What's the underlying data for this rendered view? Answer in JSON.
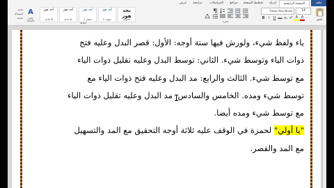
{
  "ribbon": {
    "tabs": [
      {
        "label": "ملف"
      },
      {
        "label": "الصفحة الرئيسية"
      },
      {
        "label": "إدراج"
      },
      {
        "label": "تخطيط الصفحة"
      },
      {
        "label": "مراجع"
      },
      {
        "label": "المراسلات"
      },
      {
        "label": "مراجعة"
      },
      {
        "label": "عرض"
      }
    ],
    "clipboard": {
      "paste_label": "لصق"
    },
    "font": {
      "name": "Times New Roma",
      "size": "14"
    },
    "format_buttons": [
      "B",
      "I",
      "U",
      "abc",
      "x₂",
      "x²",
      "A",
      "A"
    ],
    "paragraph_label": "فقرة",
    "styles": [
      {
        "sample": "أجد هوز",
        "name": "¶ عادي"
      },
      {
        "sample": "أجد هوز",
        "name": "بلا تباعد"
      },
      {
        "sample": "أجد هوز",
        "name": "عنوان 1"
      },
      {
        "sample": "أجد هوز",
        "name": "عنوان 2"
      },
      {
        "sample": "بجد هوز",
        "name": "العنوان"
      }
    ],
    "styles_label": "أنماط",
    "change_styles": {
      "glyph": "A",
      "label": "تغيير الأنماط"
    },
    "editing": [
      "بحث",
      "استبدال",
      "تحديد"
    ]
  },
  "document": {
    "lines": [
      "ياء ولفظ شيء، ولورش فيها ستة أوجه: الأول: قصر البدل وعليه فتح",
      "ذوات الياء وتوسط شيء. الثاني: توسط البدل وعليه تقليل ذوات الياء",
      "مع توسط شيء. الثالث والرابع: مد البدل وعليه فتح ذوات الياء مع",
      "توسط شيء ومده. الخامس والسادس: مد البدل وعليه تقليل ذوات الياء",
      "مع توسط شيء ومده أيضا."
    ],
    "highlighted_line": {
      "highlight": "\"يا أولي\"",
      "rest": " لحمزة في الوقف عليه ثلاثة أوجه التحقيق مع المد والتسهيل"
    },
    "last_line": "مع المد والقصر."
  },
  "colors": {
    "file_tab": "#2b579a",
    "highlight": "#ffff00",
    "page_border": "#5a2e0f"
  }
}
